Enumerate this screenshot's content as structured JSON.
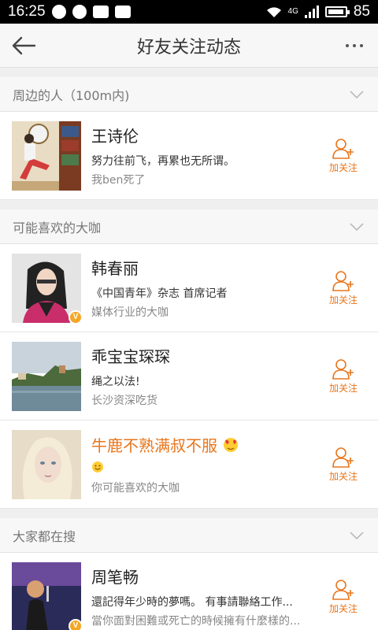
{
  "status_bar": {
    "time": "16:25",
    "network": "4G",
    "battery": "85"
  },
  "header": {
    "title": "好友关注动态"
  },
  "sections": [
    {
      "title": "周边的人（100m内)",
      "items": [
        {
          "name": "王诗伦",
          "desc": "努力往前飞，再累也无所谓。",
          "sub": "我ben死了",
          "follow": "加关注"
        }
      ]
    },
    {
      "title": "可能喜欢的大咖",
      "items": [
        {
          "name": "韩春丽",
          "desc": "《中国青年》杂志 首席记者",
          "sub": "媒体行业的大咖",
          "follow": "加关注"
        },
        {
          "name": "乖宝宝琛琛",
          "desc": "绳之以法!",
          "sub": "长沙资深吃货",
          "follow": "加关注"
        },
        {
          "name": "牛鹿不熟满叔不服",
          "desc": "",
          "sub": "你可能喜欢的大咖",
          "follow": "加关注"
        }
      ]
    },
    {
      "title": "大家都在搜",
      "items": [
        {
          "name": "周笔畅",
          "desc": "還記得年少時的夢嗎。 有事請聯絡工作...",
          "sub": "當你面對困難或死亡的時候擁有什麼樣的...",
          "follow": "加关注"
        }
      ]
    }
  ],
  "colors": {
    "accent": "#e8761c",
    "verified": "#f5a623"
  },
  "icons": [
    "back-arrow-icon",
    "more-dots-icon",
    "chevron-down-icon",
    "add-user-icon",
    "verified-badge-icon",
    "emoji-icon"
  ]
}
